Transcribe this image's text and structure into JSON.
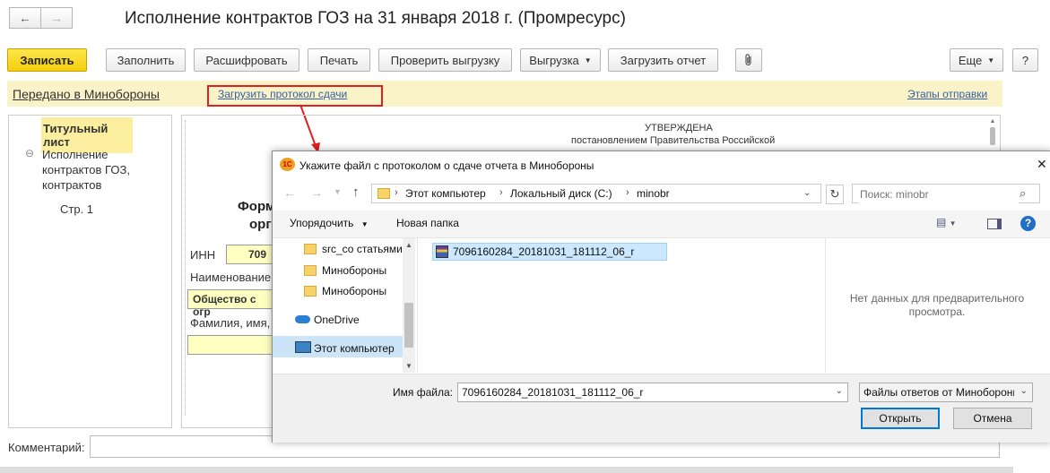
{
  "window": {
    "title": "Исполнение контрактов ГОЗ на 31 января 2018 г. (Промресурс)",
    "back_glyph": "←",
    "forward_glyph": "→"
  },
  "toolbar": {
    "save": "Записать",
    "fill": "Заполнить",
    "decode": "Расшифровать",
    "print": "Печать",
    "check_upload": "Проверить выгрузку",
    "upload": "Выгрузка",
    "load_report": "Загрузить отчет",
    "more": "Еще",
    "help": "?"
  },
  "status_bar": {
    "sent_label": "Передано в Минобороны",
    "load_protocol": "Загрузить протокол сдачи",
    "send_stages": "Этапы отправки"
  },
  "tree": {
    "items": [
      "Титульный лист",
      "Исполнение контрактов ГОЗ, контрактов",
      "Стр. 1"
    ],
    "toggle_glyph": "⊖"
  },
  "form": {
    "approved_title": "УТВЕРЖДЕНА",
    "approved_text": "постановлением Правительства Российской",
    "form_word": "Форм",
    "org_word": "орг",
    "inn_label": "ИНН",
    "inn_value": "709",
    "name_label": "Наименование",
    "org_value": "Общество с огр",
    "fio_label": "Фамилия, имя,"
  },
  "comment": {
    "label": "Комментарий:"
  },
  "dialog": {
    "title": "Укажите файл с протоколом о сдаче отчета в Минобороны",
    "logo_text": "1С",
    "close_glyph": "✕",
    "breadcrumb": [
      "Этот компьютер",
      "Локальный диск (C:)",
      "minobr"
    ],
    "search_placeholder": "Поиск: minobr",
    "organize": "Упорядочить",
    "new_folder": "Новая папка",
    "help_glyph": "?",
    "nav": [
      {
        "label": "src_со статьями"
      },
      {
        "label": "Минобороны"
      },
      {
        "label": "Минобороны"
      },
      {
        "label": "OneDrive"
      },
      {
        "label": "Этот компьютер"
      }
    ],
    "file_name_in_list": "7096160284_20181031_181112_06_r",
    "preview_text": "Нет данных для предварительного просмотра.",
    "file_name_label": "Имя файла:",
    "file_name_value": "7096160284_20181031_181112_06_r",
    "file_type": "Файлы ответов от Минобороны",
    "open": "Открыть",
    "cancel": "Отмена"
  }
}
